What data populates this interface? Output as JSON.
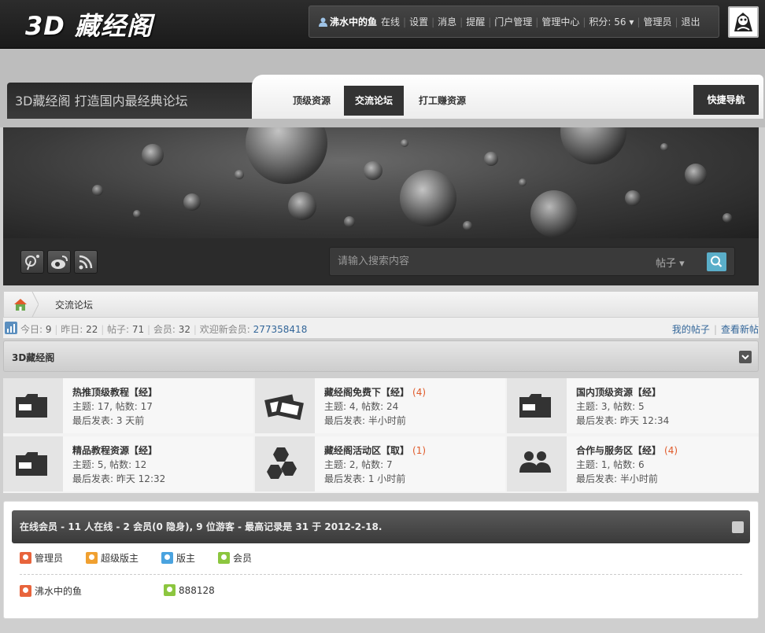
{
  "logo": "3D 藏经阁",
  "userbar": {
    "username": "沸水中的鱼",
    "status": "在线",
    "links": [
      "设置",
      "消息",
      "提醒",
      "门户管理",
      "管理中心"
    ],
    "points_label": "积分: 56",
    "admin": "管理员",
    "logout": "退出"
  },
  "header": {
    "site_title": "3D藏经阁 打造国内最经典论坛",
    "nav": [
      "顶级资源",
      "交流论坛",
      "打工赚资源"
    ],
    "quick_nav": "快捷导航"
  },
  "search": {
    "placeholder": "请输入搜索内容",
    "type": "帖子"
  },
  "breadcrumb": {
    "current": "交流论坛"
  },
  "stats": {
    "today_label": "今日:",
    "today": "9",
    "yesterday_label": "昨日:",
    "yesterday": "22",
    "posts_label": "帖子:",
    "posts": "71",
    "members_label": "会员:",
    "members": "32",
    "welcome_label": "欢迎新会员:",
    "new_member": "277358418",
    "my_posts": "我的帖子",
    "new_posts": "查看新帖"
  },
  "category": {
    "title": "3D藏经阁",
    "forums": [
      {
        "name": "热推顶级教程【经】",
        "new": "",
        "topics": "主题: 17, 帖数: 17",
        "last": "最后发表: 3 天前",
        "icon": "folder-icon"
      },
      {
        "name": "藏经阁免费下【经】",
        "new": "(4)",
        "topics": "主题: 4, 帖数: 24",
        "last": "最后发表: 半小时前",
        "icon": "tickets-icon"
      },
      {
        "name": "国内顶级资源【经】",
        "new": "",
        "topics": "主题: 3, 帖数: 5",
        "last": "最后发表: 昨天 12:34",
        "icon": "folder-icon"
      },
      {
        "name": "精品教程资源【经】",
        "new": "",
        "topics": "主题: 5, 帖数: 12",
        "last": "最后发表: 昨天 12:32",
        "icon": "folder-icon"
      },
      {
        "name": "藏经阁活动区【取】",
        "new": "(1)",
        "topics": "主题: 2, 帖数: 7",
        "last": "最后发表: 1 小时前",
        "icon": "hexagons-icon"
      },
      {
        "name": "合作与服务区【经】",
        "new": "(4)",
        "topics": "主题: 1, 帖数: 6",
        "last": "最后发表: 半小时前",
        "icon": "users-icon"
      }
    ]
  },
  "online": {
    "title": "在线会员 - 11 人在线 - 2 会员(0 隐身), 9 位游客 - 最高记录是 31 于 2012-2-18.",
    "legend": [
      {
        "label": "管理员",
        "color": "#e8643c"
      },
      {
        "label": "超级版主",
        "color": "#f0a030"
      },
      {
        "label": "版主",
        "color": "#4aa3df"
      },
      {
        "label": "会员",
        "color": "#8cc63f"
      }
    ],
    "members": [
      {
        "name": "沸水中的鱼",
        "color": "#e8643c"
      },
      {
        "name": "888128",
        "color": "#8cc63f"
      }
    ]
  },
  "colors": {
    "accent": "#5aaec9",
    "link": "#336699",
    "new_count": "#e05a2a"
  }
}
